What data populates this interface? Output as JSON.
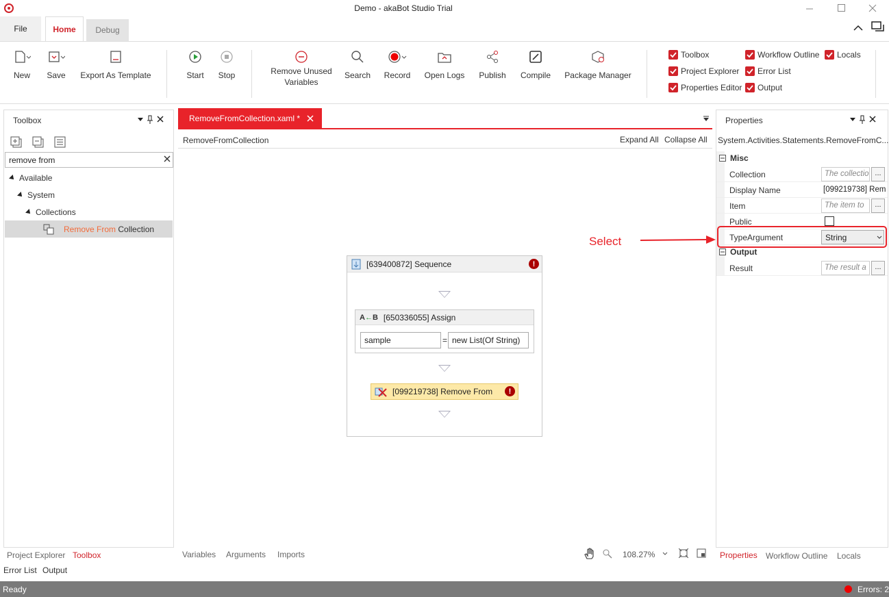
{
  "window": {
    "title": "Demo - akaBot Studio Trial"
  },
  "ribbon_tabs": {
    "file": "File",
    "home": "Home",
    "debug": "Debug"
  },
  "ribbon": {
    "new": "New",
    "save": "Save",
    "export_template": "Export As Template",
    "start": "Start",
    "stop": "Stop",
    "remove_unused_1": "Remove Unused",
    "remove_unused_2": "Variables",
    "search": "Search",
    "record": "Record",
    "open_logs": "Open Logs",
    "publish": "Publish",
    "compile": "Compile",
    "package_manager": "Package Manager"
  },
  "view_toggles": {
    "toolbox": "Toolbox",
    "project_explorer": "Project Explorer",
    "properties_editor": "Properties Editor",
    "workflow_outline": "Workflow Outline",
    "error_list": "Error List",
    "output": "Output",
    "locals": "Locals"
  },
  "toolbox": {
    "title": "Toolbox",
    "search_value": "remove from",
    "tree": {
      "available": "Available",
      "system": "System",
      "collections": "Collections",
      "item_highlight": "Remove From",
      "item_rest": " Collection"
    },
    "bottom_tabs": {
      "project_explorer": "Project Explorer",
      "toolbox": "Toolbox"
    }
  },
  "lower_tabs": {
    "error_list": "Error List",
    "output": "Output"
  },
  "designer": {
    "tab_title": "RemoveFromCollection.xaml *",
    "breadcrumb": "RemoveFromCollection",
    "expand_all": "Expand All",
    "collapse_all": "Collapse All",
    "sequence_title": "[639400872] Sequence",
    "assign_title": "[650336055] Assign",
    "assign_to": "sample",
    "assign_eq": "=",
    "assign_value": "new List(Of String)",
    "remove_title": "[099219738] Remove From",
    "bottom_tabs": {
      "variables": "Variables",
      "arguments": "Arguments",
      "imports": "Imports"
    },
    "zoom": "108.27%"
  },
  "annotation": {
    "text": "Select",
    "color": "#e8232a"
  },
  "properties": {
    "title": "Properties",
    "type_name": "System.Activities.Statements.RemoveFromC...",
    "misc": "Misc",
    "collection_name": "Collection",
    "collection_ph": "The collectio",
    "display_name_name": "Display Name",
    "display_name_value": "[099219738] Rem",
    "item_name": "Item",
    "item_ph": "The item to",
    "public_name": "Public",
    "type_argument_name": "TypeArgument",
    "type_argument_value": "String",
    "output": "Output",
    "result_name": "Result",
    "result_ph": "The result a",
    "ellipsis": "...",
    "bottom_tabs": {
      "properties": "Properties",
      "workflow_outline": "Workflow Outline",
      "locals": "Locals"
    }
  },
  "status": {
    "ready": "Ready",
    "errors": "Errors: 2"
  },
  "colors": {
    "accent": "#d0232a",
    "status_bar": "#7a7a7a",
    "warning_fill": "#fde9a8"
  }
}
